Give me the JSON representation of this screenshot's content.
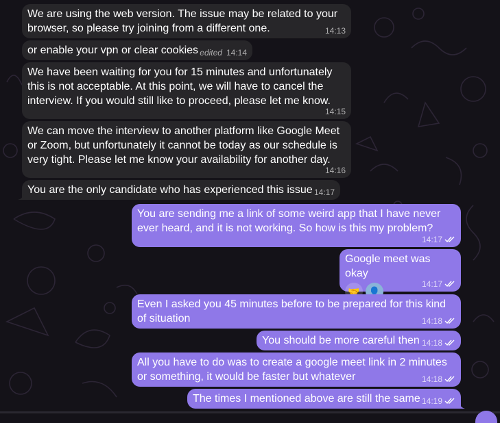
{
  "theme": {
    "incoming_bubble": "#272629",
    "outgoing_bubble": "#8f78e8",
    "background": "#141218",
    "text": "#ffffff"
  },
  "messages": [
    {
      "dir": "in",
      "text": "We are using the web version. The issue may be related to your browser, so please try joining from a different one.",
      "time": "14:13",
      "edited": ""
    },
    {
      "dir": "in",
      "text": "or enable your vpn or clear cookies",
      "time": "14:14",
      "edited": "edited"
    },
    {
      "dir": "in",
      "text": "We have been waiting for you for 15 minutes and unfortunately this is not acceptable. At this point, we will have to cancel the interview. If you would still like to proceed, please let me know.",
      "time": "14:15",
      "edited": ""
    },
    {
      "dir": "in",
      "text": "We can move the interview to another platform like Google Meet or Zoom, but unfortunately it cannot be today as our schedule is very tight. Please let me know your availability for another day.",
      "time": "14:16",
      "edited": ""
    },
    {
      "dir": "in",
      "text": "You are the only candidate who has experienced this issue",
      "time": "14:17",
      "edited": ""
    },
    {
      "dir": "out",
      "text": "You are sending me a link of some weird app that I have never ever heard, and it is not working. So how is this my problem?",
      "time": "14:17",
      "read": "read-double-check-icon"
    },
    {
      "dir": "out",
      "text": "Google meet was okay",
      "time": "14:17",
      "read": "read-double-check-icon",
      "reactions": [
        {
          "emoji": "🤝",
          "icon": "handshake-emoji"
        },
        {
          "emoji": "👤",
          "icon": "reactor-avatar"
        }
      ]
    },
    {
      "dir": "out",
      "text": "Even I asked you 45 minutes before to be prepared for this kind of situation",
      "time": "14:18",
      "read": "read-double-check-icon"
    },
    {
      "dir": "out",
      "text": "You should be more careful then",
      "time": "14:18",
      "read": "read-double-check-icon"
    },
    {
      "dir": "out",
      "text": "All you have to do was to create a google meet link in 2 minutes or something, it would be faster but whatever",
      "time": "14:18",
      "read": "read-double-check-icon"
    },
    {
      "dir": "out",
      "text": "The times I mentioned above are still the same",
      "time": "14:19",
      "read": "read-double-check-icon"
    }
  ]
}
